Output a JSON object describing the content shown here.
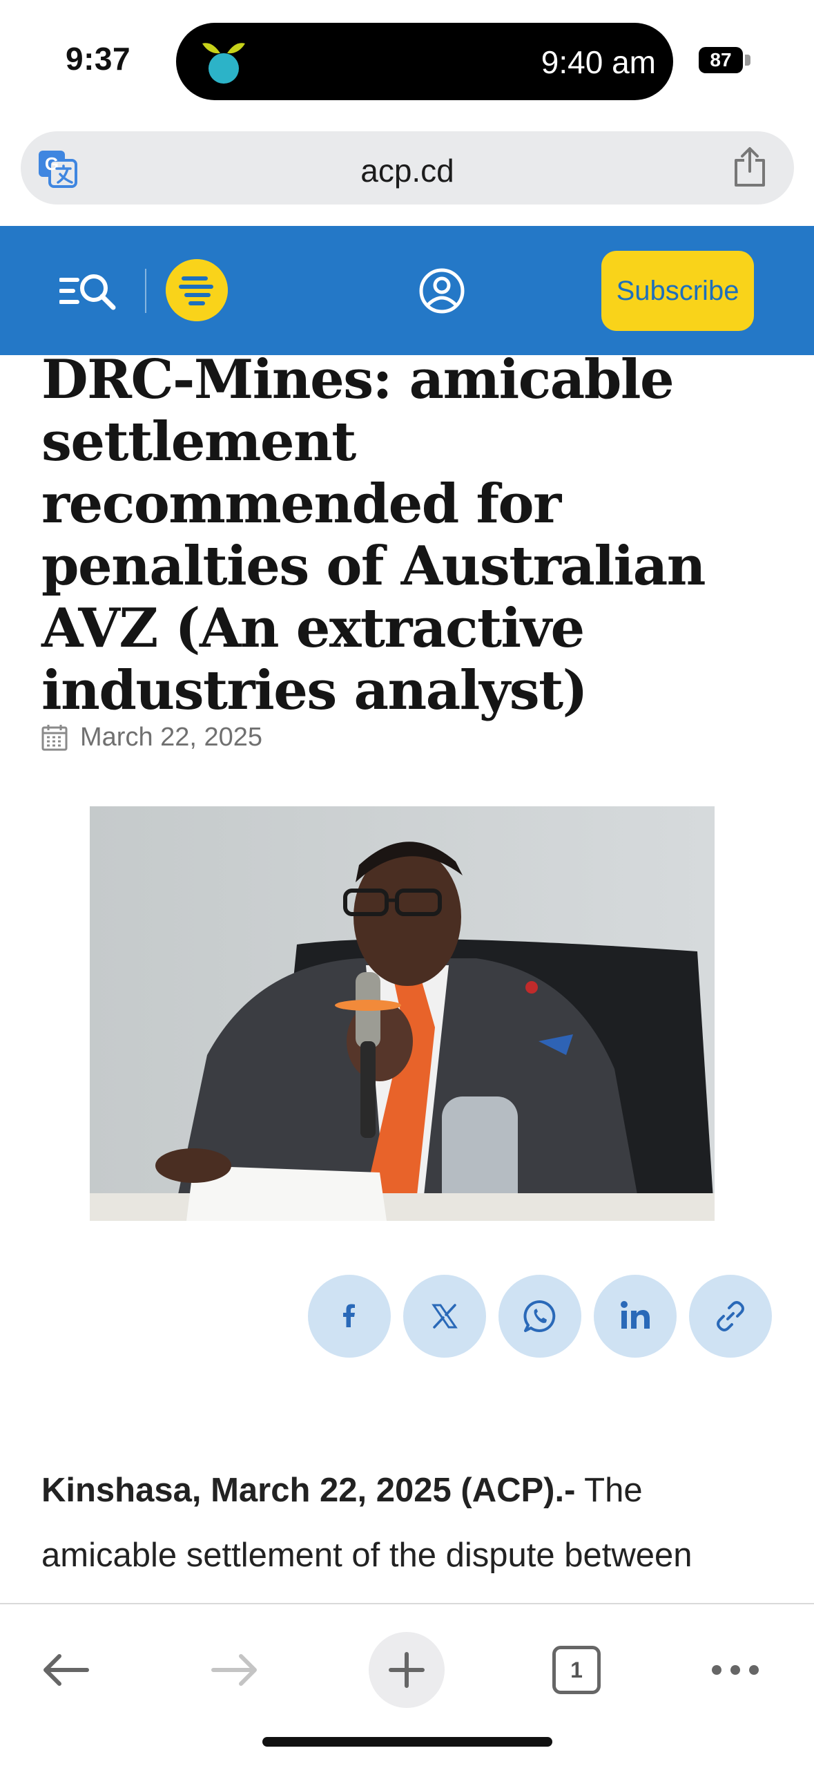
{
  "status_bar": {
    "time": "9:37",
    "island_time": "9:40 am",
    "battery": "87"
  },
  "browser": {
    "url": "acp.cd"
  },
  "site_header": {
    "subscribe_label": "Subscribe",
    "brand_color": "#2478c7",
    "accent_color": "#f9d31a"
  },
  "article": {
    "headline": "DRC-Mines: amicable settlement recommended for penalties of Australian AVZ (An extractive industries analyst)",
    "date": "March 22, 2025",
    "dateline": "Kinshasa, March 22, 2025 (ACP).-",
    "body_start": " The amicable settlement of the dispute between"
  },
  "share_buttons": [
    {
      "icon": "facebook-icon"
    },
    {
      "icon": "x-icon"
    },
    {
      "icon": "whatsapp-icon"
    },
    {
      "icon": "linkedin-icon"
    },
    {
      "icon": "link-icon"
    }
  ],
  "toolbar": {
    "tab_count": "1"
  }
}
